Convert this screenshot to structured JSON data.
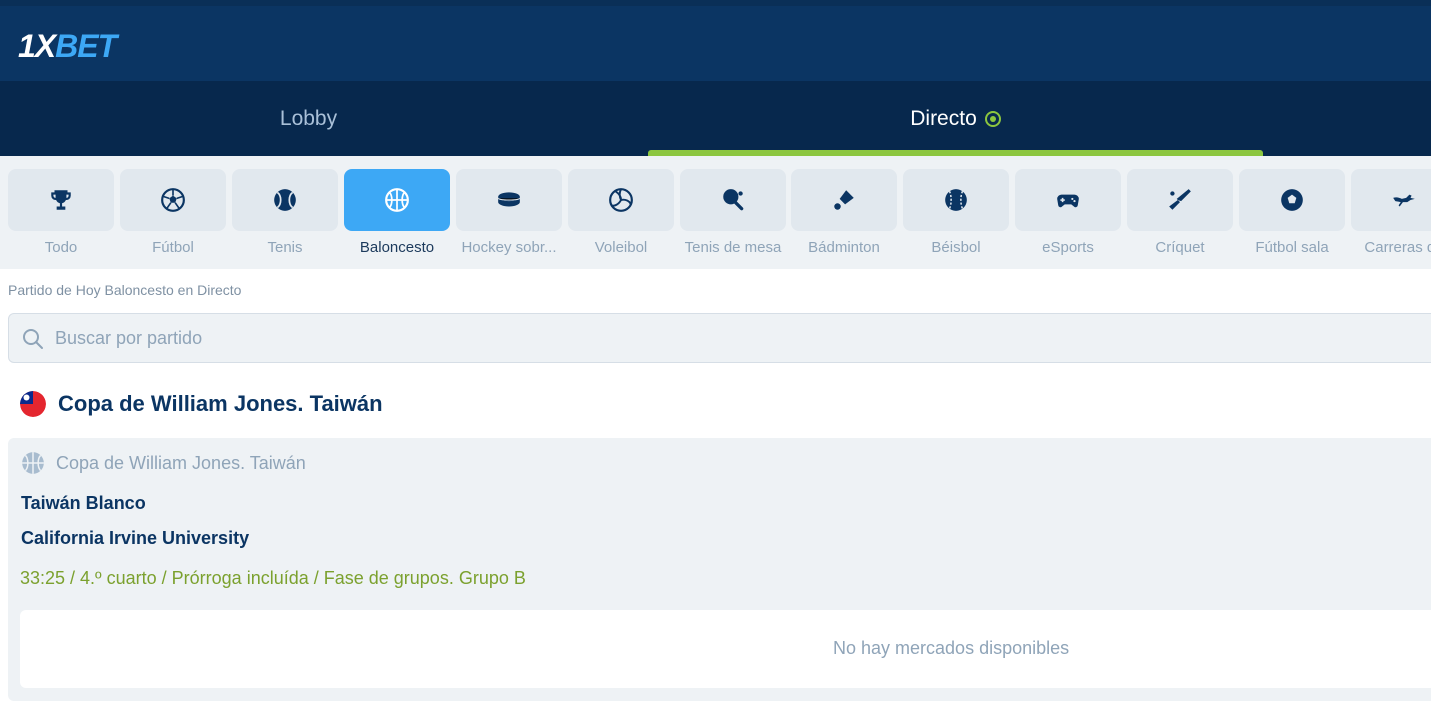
{
  "header": {
    "logo_main": "1X",
    "logo_accent": "BET"
  },
  "tabs": [
    {
      "label": "Lobby"
    },
    {
      "label": "Directo"
    }
  ],
  "sports": [
    {
      "label": "Todo",
      "icon": "trophy-icon"
    },
    {
      "label": "Fútbol",
      "icon": "soccer-ball-icon"
    },
    {
      "label": "Tenis",
      "icon": "tennis-ball-icon"
    },
    {
      "label": "Baloncesto",
      "icon": "basketball-icon"
    },
    {
      "label": "Hockey sobr...",
      "icon": "hockey-puck-icon"
    },
    {
      "label": "Voleibol",
      "icon": "volleyball-icon"
    },
    {
      "label": "Tenis de mesa",
      "icon": "ping-pong-icon"
    },
    {
      "label": "Bádminton",
      "icon": "shuttlecock-icon"
    },
    {
      "label": "Béisbol",
      "icon": "baseball-icon"
    },
    {
      "label": "eSports",
      "icon": "gamepad-icon"
    },
    {
      "label": "Críquet",
      "icon": "cricket-bat-icon"
    },
    {
      "label": "Fútbol sala",
      "icon": "futsal-ball-icon"
    },
    {
      "label": "Carreras de",
      "icon": "greyhound-icon"
    }
  ],
  "active_sport": "Baloncesto",
  "breadcrumb": "Partido de Hoy Baloncesto en Directo",
  "search": {
    "placeholder": "Buscar por partido",
    "value": ""
  },
  "league": {
    "title": "Copa de William Jones. Taiwán",
    "flag": "taiwan-flag-icon"
  },
  "event": {
    "league": "Copa de William Jones. Taiwán",
    "team1": "Taiwán Blanco",
    "team2": "California Irvine University",
    "status": "33:25 / 4.º cuarto / Prórroga incluída / Fase de grupos. Grupo B",
    "markets_message": "No hay mercados disponibles"
  },
  "colors": {
    "header_bg": "#0b3563",
    "tabs_bg": "#07284d",
    "live_green": "#8cc63f",
    "active_blue": "#3da8f5",
    "status_green": "#7ba12e"
  }
}
